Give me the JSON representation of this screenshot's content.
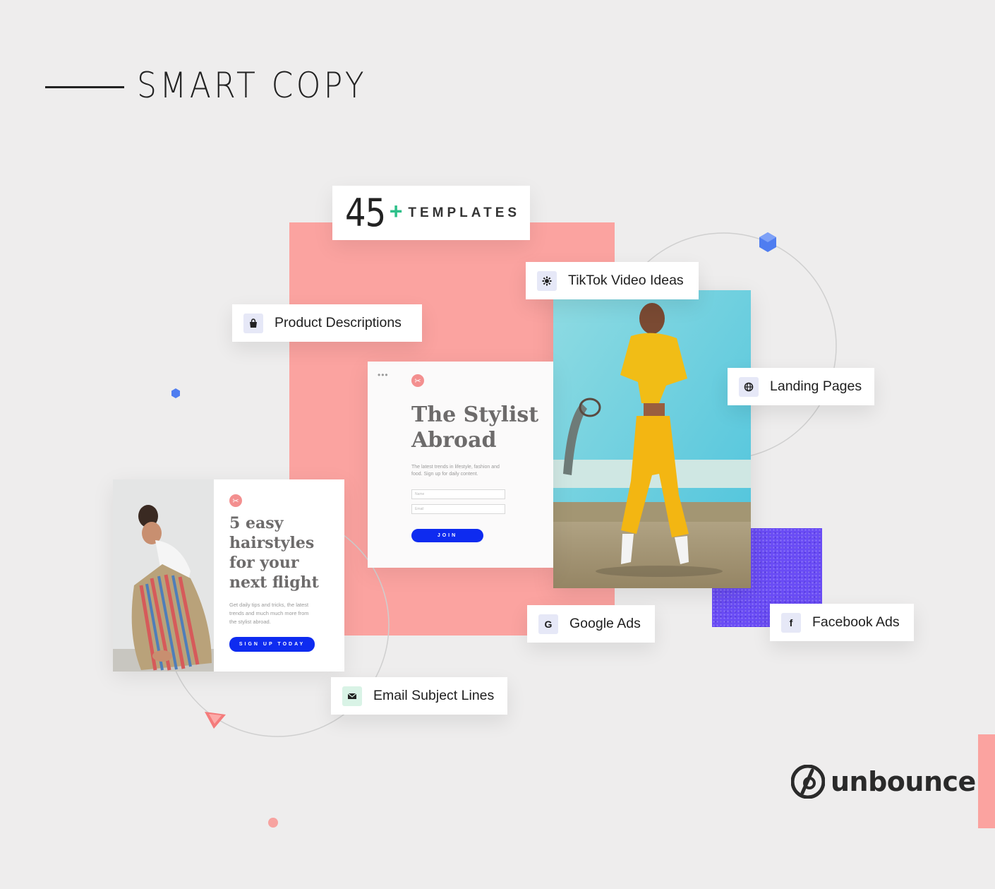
{
  "header": {
    "title": "SMART COPY"
  },
  "templates": {
    "number": "45",
    "plus": "+",
    "word": "TEMPLATES"
  },
  "chips": {
    "tiktok": {
      "label": "TikTok Video Ideas",
      "icon": "gear-icon"
    },
    "product": {
      "label": "Product Descriptions",
      "icon": "shopping-bag-icon"
    },
    "landing": {
      "label": "Landing Pages",
      "icon": "globe-icon"
    },
    "google": {
      "label": "Google Ads",
      "icon": "google-icon",
      "glyph": "G"
    },
    "facebook": {
      "label": "Facebook Ads",
      "icon": "facebook-icon",
      "glyph": "f"
    },
    "email": {
      "label": "Email Subject Lines",
      "icon": "envelope-icon"
    }
  },
  "center_card": {
    "dots": "•••",
    "title": "The Stylist Abroad",
    "subtitle": "The latest trends in lifestyle, fashion and food. Sign up for daily content.",
    "name_placeholder": "Name",
    "email_placeholder": "Email",
    "button": "JOIN"
  },
  "left_card": {
    "title": "5 easy hairstyles for your next flight",
    "subtitle": "Get daily tips and tricks, the latest trends and much much more from the stylist abroad.",
    "button": "SIGN UP TODAY"
  },
  "logo": {
    "text": "unbounce"
  },
  "colors": {
    "background": "#eeeded",
    "pink": "#fba3a0",
    "purple": "#6a4cf5",
    "button_blue": "#0e2bf0",
    "accent_green": "#2ec08a",
    "hex_blue": "#4f7df0"
  }
}
